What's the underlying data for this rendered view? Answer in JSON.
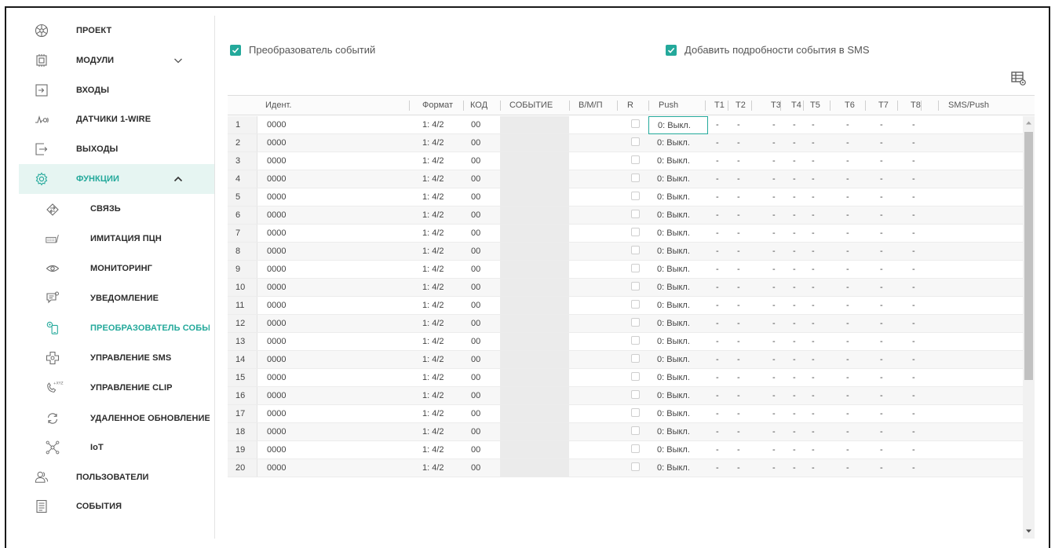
{
  "sidebar": {
    "items": [
      {
        "label": "ПРОЕКТ",
        "icon": "project-icon"
      },
      {
        "label": "МОДУЛИ",
        "icon": "modules-icon",
        "expand": "chevron-down-icon"
      },
      {
        "label": "ВХОДЫ",
        "icon": "inputs-icon"
      },
      {
        "label": "ДАТЧИКИ 1-WIRE",
        "icon": "sensor-icon"
      },
      {
        "label": "ВЫХОДЫ",
        "icon": "outputs-icon"
      },
      {
        "label": "ФУНКЦИИ",
        "icon": "gear-icon",
        "expand": "chevron-up-icon",
        "active": true
      },
      {
        "label": "СВЯЗЬ",
        "icon": "connection-icon",
        "sub": true
      },
      {
        "label": "ИМИТАЦИЯ ПЦН",
        "icon": "keyboard-icon",
        "sub": true
      },
      {
        "label": "МОНИТОРИНГ",
        "icon": "eye-icon",
        "sub": true
      },
      {
        "label": "УВЕДОМЛЕНИЕ",
        "icon": "chat-icon",
        "sub": true
      },
      {
        "label": "ПРЕОБРАЗОВАТЕЛЬ СОБЫ...",
        "icon": "converter-icon",
        "sub": true,
        "selected": true
      },
      {
        "label": "УПРАВЛЕНИЕ SMS",
        "icon": "sms-control-icon",
        "sub": true
      },
      {
        "label": "УПРАВЛЕНИЕ CLIP",
        "icon": "clip-icon",
        "sub": true
      },
      {
        "label": "УДАЛЕННОЕ ОБНОВЛЕНИЕ",
        "icon": "refresh-icon",
        "sub": true
      },
      {
        "label": "IoT",
        "icon": "iot-icon",
        "sub": true
      },
      {
        "label": "ПОЛЬЗОВАТЕЛИ",
        "icon": "users-icon"
      },
      {
        "label": "СОБЫТИЯ",
        "icon": "events-icon"
      }
    ]
  },
  "options": {
    "converter_label": "Преобразователь событий",
    "converter_checked": true,
    "sms_details_label": "Добавить подробности события в SMS",
    "sms_details_checked": true
  },
  "table": {
    "columns": {
      "ident": "Идент.",
      "format": "Формат",
      "code": "КОД",
      "event": "СОБЫТИЕ",
      "vmp": "В/М/П",
      "r": "R",
      "push": "Push",
      "t1": "T1",
      "t2": "T2",
      "t3": "T3",
      "t4": "T4",
      "t5": "T5",
      "t6": "T6",
      "t7": "T7",
      "t8": "T8",
      "sms_push": "SMS/Push"
    },
    "rows": [
      {
        "n": "1",
        "ident": "0000",
        "format": "1: 4/2",
        "code": "00",
        "push": "0: Выкл.",
        "t": [
          "-",
          "-",
          "-",
          "-",
          "-",
          "-",
          "-",
          "-"
        ]
      },
      {
        "n": "2",
        "ident": "0000",
        "format": "1: 4/2",
        "code": "00",
        "push": "0: Выкл.",
        "t": [
          "-",
          "-",
          "-",
          "-",
          "-",
          "-",
          "-",
          "-"
        ]
      },
      {
        "n": "3",
        "ident": "0000",
        "format": "1: 4/2",
        "code": "00",
        "push": "0: Выкл.",
        "t": [
          "-",
          "-",
          "-",
          "-",
          "-",
          "-",
          "-",
          "-"
        ]
      },
      {
        "n": "4",
        "ident": "0000",
        "format": "1: 4/2",
        "code": "00",
        "push": "0: Выкл.",
        "t": [
          "-",
          "-",
          "-",
          "-",
          "-",
          "-",
          "-",
          "-"
        ]
      },
      {
        "n": "5",
        "ident": "0000",
        "format": "1: 4/2",
        "code": "00",
        "push": "0: Выкл.",
        "t": [
          "-",
          "-",
          "-",
          "-",
          "-",
          "-",
          "-",
          "-"
        ]
      },
      {
        "n": "6",
        "ident": "0000",
        "format": "1: 4/2",
        "code": "00",
        "push": "0: Выкл.",
        "t": [
          "-",
          "-",
          "-",
          "-",
          "-",
          "-",
          "-",
          "-"
        ]
      },
      {
        "n": "7",
        "ident": "0000",
        "format": "1: 4/2",
        "code": "00",
        "push": "0: Выкл.",
        "t": [
          "-",
          "-",
          "-",
          "-",
          "-",
          "-",
          "-",
          "-"
        ]
      },
      {
        "n": "8",
        "ident": "0000",
        "format": "1: 4/2",
        "code": "00",
        "push": "0: Выкл.",
        "t": [
          "-",
          "-",
          "-",
          "-",
          "-",
          "-",
          "-",
          "-"
        ]
      },
      {
        "n": "9",
        "ident": "0000",
        "format": "1: 4/2",
        "code": "00",
        "push": "0: Выкл.",
        "t": [
          "-",
          "-",
          "-",
          "-",
          "-",
          "-",
          "-",
          "-"
        ]
      },
      {
        "n": "10",
        "ident": "0000",
        "format": "1: 4/2",
        "code": "00",
        "push": "0: Выкл.",
        "t": [
          "-",
          "-",
          "-",
          "-",
          "-",
          "-",
          "-",
          "-"
        ]
      },
      {
        "n": "11",
        "ident": "0000",
        "format": "1: 4/2",
        "code": "00",
        "push": "0: Выкл.",
        "t": [
          "-",
          "-",
          "-",
          "-",
          "-",
          "-",
          "-",
          "-"
        ]
      },
      {
        "n": "12",
        "ident": "0000",
        "format": "1: 4/2",
        "code": "00",
        "push": "0: Выкл.",
        "t": [
          "-",
          "-",
          "-",
          "-",
          "-",
          "-",
          "-",
          "-"
        ]
      },
      {
        "n": "13",
        "ident": "0000",
        "format": "1: 4/2",
        "code": "00",
        "push": "0: Выкл.",
        "t": [
          "-",
          "-",
          "-",
          "-",
          "-",
          "-",
          "-",
          "-"
        ]
      },
      {
        "n": "14",
        "ident": "0000",
        "format": "1: 4/2",
        "code": "00",
        "push": "0: Выкл.",
        "t": [
          "-",
          "-",
          "-",
          "-",
          "-",
          "-",
          "-",
          "-"
        ]
      },
      {
        "n": "15",
        "ident": "0000",
        "format": "1: 4/2",
        "code": "00",
        "push": "0: Выкл.",
        "t": [
          "-",
          "-",
          "-",
          "-",
          "-",
          "-",
          "-",
          "-"
        ]
      },
      {
        "n": "16",
        "ident": "0000",
        "format": "1: 4/2",
        "code": "00",
        "push": "0: Выкл.",
        "t": [
          "-",
          "-",
          "-",
          "-",
          "-",
          "-",
          "-",
          "-"
        ]
      },
      {
        "n": "17",
        "ident": "0000",
        "format": "1: 4/2",
        "code": "00",
        "push": "0: Выкл.",
        "t": [
          "-",
          "-",
          "-",
          "-",
          "-",
          "-",
          "-",
          "-"
        ]
      },
      {
        "n": "18",
        "ident": "0000",
        "format": "1: 4/2",
        "code": "00",
        "push": "0: Выкл.",
        "t": [
          "-",
          "-",
          "-",
          "-",
          "-",
          "-",
          "-",
          "-"
        ]
      },
      {
        "n": "19",
        "ident": "0000",
        "format": "1: 4/2",
        "code": "00",
        "push": "0: Выкл.",
        "t": [
          "-",
          "-",
          "-",
          "-",
          "-",
          "-",
          "-",
          "-"
        ]
      },
      {
        "n": "20",
        "ident": "0000",
        "format": "1: 4/2",
        "code": "00",
        "push": "0: Выкл.",
        "t": [
          "-",
          "-",
          "-",
          "-",
          "-",
          "-",
          "-",
          "-"
        ]
      }
    ],
    "selected_row": 1,
    "selected_column": "push"
  },
  "colors": {
    "accent": "#24a99b",
    "active_bg": "#e6f5f2",
    "text": "#2c2c2c",
    "muted": "#555555"
  }
}
